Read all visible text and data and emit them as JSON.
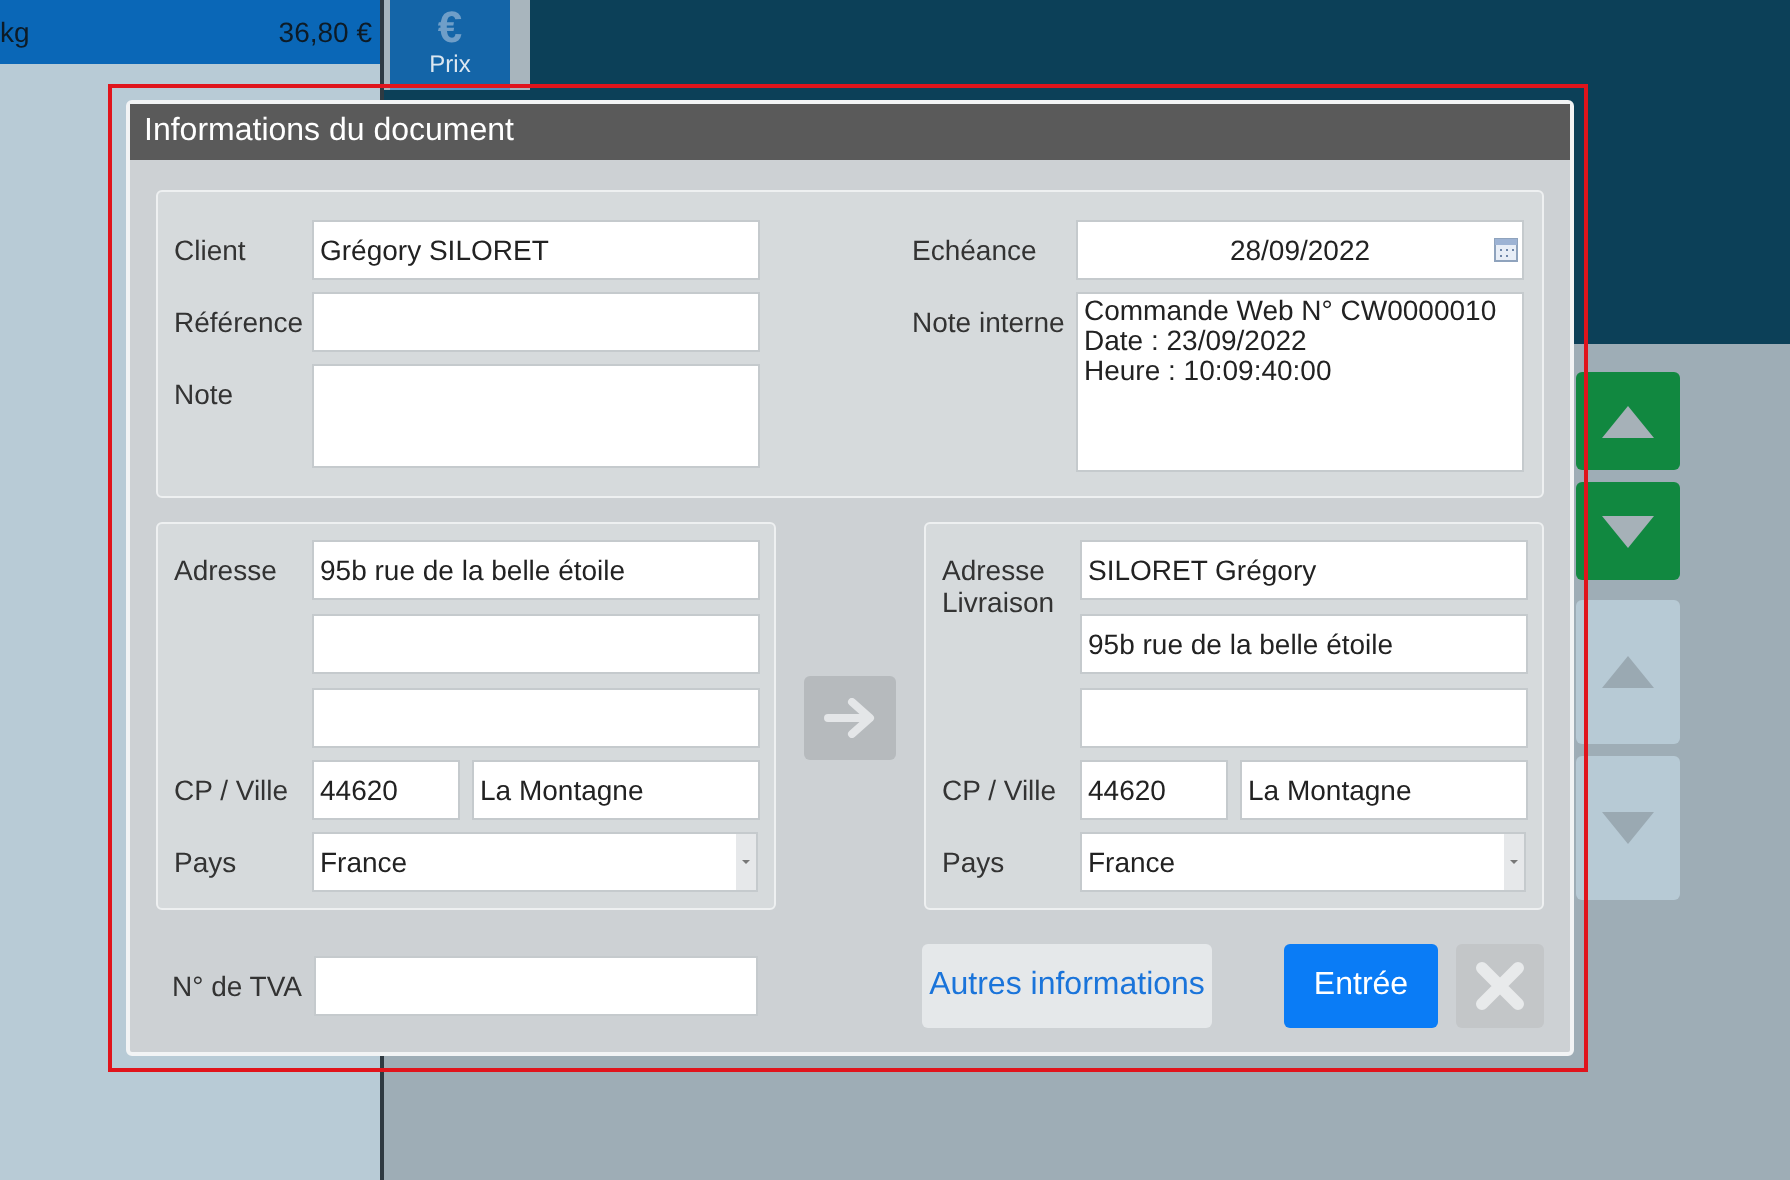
{
  "background": {
    "list_row": {
      "unit": "kg",
      "price": "36,80 €"
    },
    "price_button": {
      "icon": "€",
      "label": "Prix"
    },
    "scroll_buttons": [
      {
        "kind": "up",
        "disabled": false
      },
      {
        "kind": "down",
        "disabled": false
      },
      {
        "kind": "up",
        "disabled": true
      },
      {
        "kind": "down",
        "disabled": true
      }
    ]
  },
  "dialog": {
    "title": "Informations du document",
    "client": {
      "label": "Client",
      "value": "Grégory SILORET"
    },
    "reference": {
      "label": "Référence"
    },
    "note": {
      "label": "Note"
    },
    "due_date": {
      "label": "Echéance",
      "value": "28/09/2022"
    },
    "internal_note": {
      "label": "Note interne",
      "value": "Commande Web N° CW0000010\nDate : 23/09/2022\nHeure : 10:09:40:00"
    },
    "address": {
      "label": "Adresse",
      "lines": [
        {
          "kind": "text",
          "value": "95b rue de la belle étoile"
        },
        {
          "kind": "blank"
        },
        {
          "kind": "blank"
        }
      ],
      "postcode_label": "CP / Ville",
      "postcode": "44620",
      "city": "La Montagne",
      "country_label": "Pays",
      "country": "France"
    },
    "delivery_address": {
      "label": "Adresse Livraison",
      "lines": [
        {
          "kind": "text",
          "value": "SILORET Grégory"
        },
        {
          "kind": "text",
          "value": "95b rue de la belle étoile"
        },
        {
          "kind": "blank"
        }
      ],
      "postcode_label": "CP / Ville",
      "postcode": "44620",
      "city": "La Montagne",
      "country_label": "Pays",
      "country": "France"
    },
    "vat": {
      "label": "N° de TVA"
    },
    "buttons": [
      {
        "kind": "secondary",
        "label": "Autres informations",
        "disabled": false
      },
      {
        "kind": "primary",
        "label": "Entrée",
        "disabled": false
      },
      {
        "kind": "close",
        "disabled": true
      }
    ]
  }
}
